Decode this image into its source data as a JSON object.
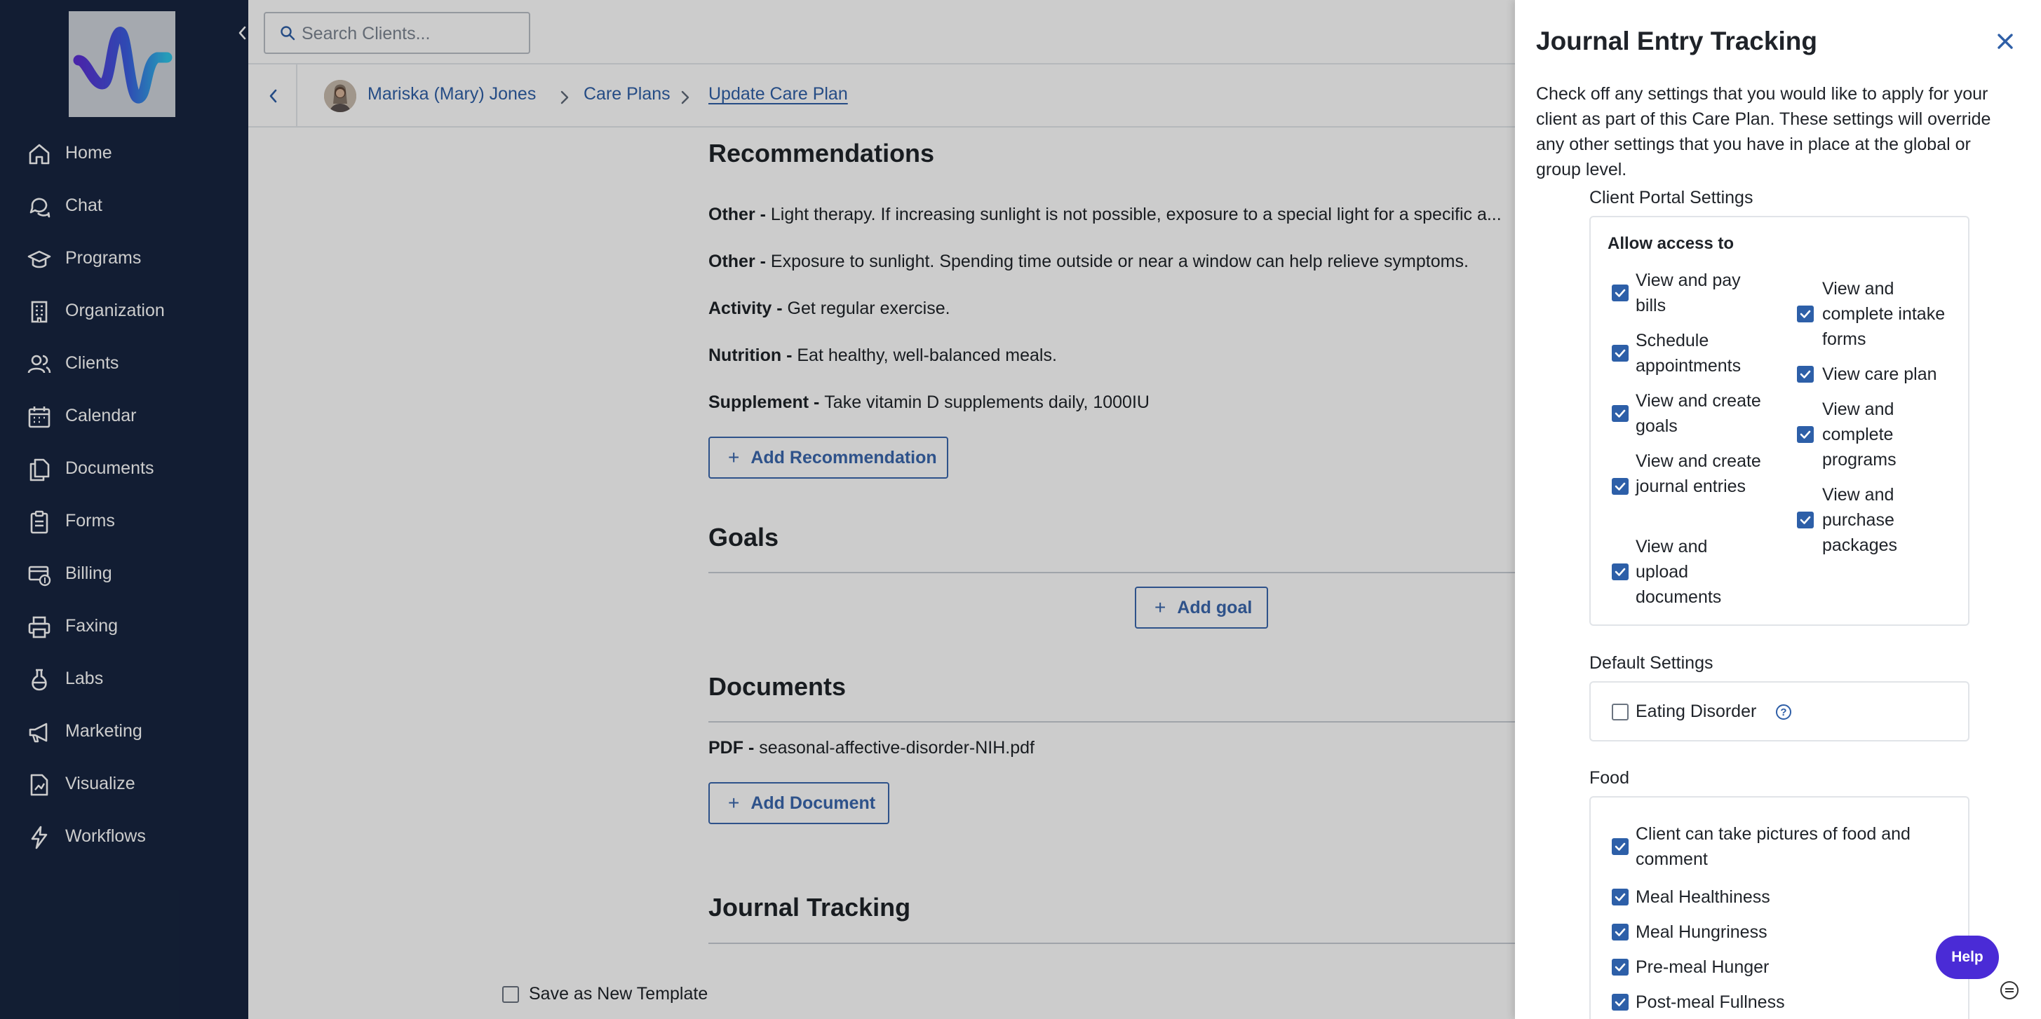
{
  "search": {
    "placeholder": "Search Clients..."
  },
  "sidebar": {
    "items": [
      {
        "label": "Home",
        "icon": "home-icon"
      },
      {
        "label": "Chat",
        "icon": "chat-icon"
      },
      {
        "label": "Programs",
        "icon": "graduation-cap-icon"
      },
      {
        "label": "Organization",
        "icon": "building-icon"
      },
      {
        "label": "Clients",
        "icon": "users-icon"
      },
      {
        "label": "Calendar",
        "icon": "calendar-icon"
      },
      {
        "label": "Documents",
        "icon": "documents-icon"
      },
      {
        "label": "Forms",
        "icon": "clipboard-icon"
      },
      {
        "label": "Billing",
        "icon": "billing-icon"
      },
      {
        "label": "Faxing",
        "icon": "printer-icon"
      },
      {
        "label": "Labs",
        "icon": "flask-icon"
      },
      {
        "label": "Marketing",
        "icon": "megaphone-icon"
      },
      {
        "label": "Visualize",
        "icon": "chart-file-icon"
      },
      {
        "label": "Workflows",
        "icon": "lightning-icon"
      }
    ]
  },
  "breadcrumb": {
    "client": "Mariska (Mary) Jones",
    "section": "Care Plans",
    "current": "Update Care Plan"
  },
  "recommendations": {
    "title": "Recommendations",
    "items": [
      {
        "type": "Other - ",
        "text": "Light therapy.  If increasing sunlight is not possible, exposure to a special light for a specific a..."
      },
      {
        "type": "Other - ",
        "text": "Exposure to sunlight.  Spending time outside or near a window can help relieve symptoms."
      },
      {
        "type": "Activity - ",
        "text": "Get regular exercise."
      },
      {
        "type": "Nutrition - ",
        "text": "Eat healthy, well-balanced meals."
      },
      {
        "type": "Supplement - ",
        "text": "Take vitamin D supplements daily, 1000IU"
      }
    ],
    "add_label": "Add Recommendation"
  },
  "goals": {
    "title": "Goals",
    "add_label": "Add goal"
  },
  "documents": {
    "title": "Documents",
    "items": [
      {
        "type": "PDF - ",
        "text": "seasonal-affective-disorder-NIH.pdf"
      }
    ],
    "add_label": "Add Document"
  },
  "journal": {
    "title": "Journal Tracking",
    "save_template_label": "Save as New Template",
    "save_template_checked": false
  },
  "drawer": {
    "title": "Journal Entry Tracking",
    "description": "Check off any settings that you would like to apply for your client as part of this Care Plan. These settings will override any other settings that you have in place at the global or group level.",
    "portal": {
      "label": "Client Portal Settings",
      "allow_title": "Allow access to",
      "left": [
        {
          "label": "View and pay bills",
          "checked": true
        },
        {
          "label": "Schedule appointments",
          "checked": true
        },
        {
          "label": "View and create goals",
          "checked": true
        },
        {
          "label": "View and create journal entries",
          "checked": true
        },
        {
          "label": "View and upload documents",
          "checked": true
        }
      ],
      "right": [
        {
          "label": "View and complete intake forms",
          "checked": true
        },
        {
          "label": "View care plan",
          "checked": true
        },
        {
          "label": "View and complete programs",
          "checked": true
        },
        {
          "label": "View and purchase packages",
          "checked": true
        }
      ]
    },
    "defaults": {
      "label": "Default Settings",
      "items": [
        {
          "label": "Eating Disorder",
          "checked": false
        }
      ]
    },
    "food": {
      "label": "Food",
      "items": [
        {
          "label": "Client can take pictures of food and comment",
          "checked": true
        },
        {
          "label": "Meal Healthiness",
          "checked": true
        },
        {
          "label": "Meal Hungriness",
          "checked": true
        },
        {
          "label": "Pre-meal Hunger",
          "checked": true
        },
        {
          "label": "Post-meal Fullness",
          "checked": true
        }
      ]
    }
  },
  "help": {
    "label": "Help"
  },
  "colors": {
    "sidebar": "#172540",
    "accent": "#2d5fa8",
    "help": "#4a2bd6"
  }
}
